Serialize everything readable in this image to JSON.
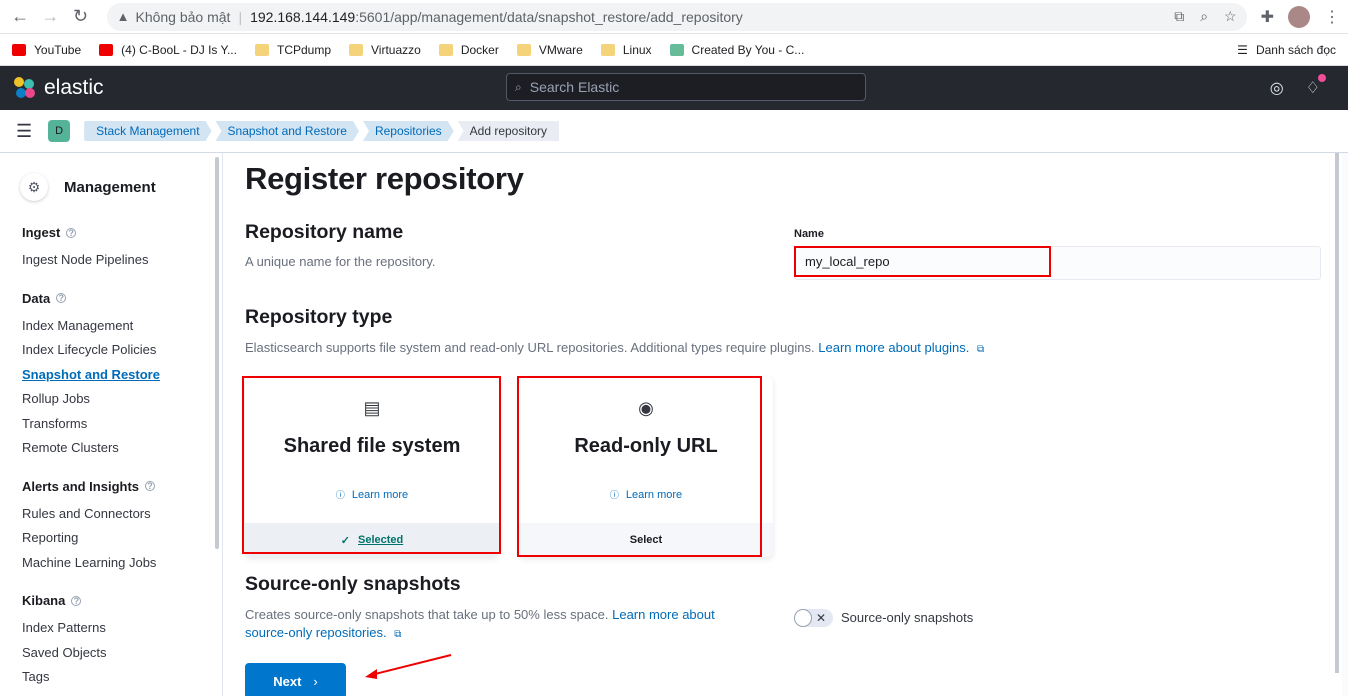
{
  "browser": {
    "insecure_label": "Không bảo mật",
    "url_host": "192.168.144.149",
    "url_path": ":5601/app/management/data/snapshot_restore/add_repository",
    "bookmarks": [
      {
        "label": "YouTube",
        "icon": "youtube-icon"
      },
      {
        "label": "(4) C-BooL - DJ Is Y...",
        "icon": "youtube-icon"
      },
      {
        "label": "TCPdump",
        "icon": "folder-icon"
      },
      {
        "label": "Virtuazzo",
        "icon": "folder-icon"
      },
      {
        "label": "Docker",
        "icon": "folder-icon"
      },
      {
        "label": "VMware",
        "icon": "folder-icon"
      },
      {
        "label": "Linux",
        "icon": "folder-icon"
      },
      {
        "label": "Created By You - C...",
        "icon": "created-icon"
      }
    ],
    "reading_list": "Danh sách đọc"
  },
  "header": {
    "logo_text": "elastic",
    "search_placeholder": "Search Elastic",
    "space_initial": "D"
  },
  "breadcrumbs": [
    "Stack Management",
    "Snapshot and Restore",
    "Repositories",
    "Add repository"
  ],
  "sidenav": {
    "title": "Management",
    "groups": [
      {
        "title": "Ingest",
        "items": [
          "Ingest Node Pipelines"
        ]
      },
      {
        "title": "Data",
        "items": [
          "Index Management",
          "Index Lifecycle Policies",
          "Snapshot and Restore",
          "Rollup Jobs",
          "Transforms",
          "Remote Clusters"
        ]
      },
      {
        "title": "Alerts and Insights",
        "items": [
          "Rules and Connectors",
          "Reporting",
          "Machine Learning Jobs"
        ]
      },
      {
        "title": "Kibana",
        "items": [
          "Index Patterns",
          "Saved Objects",
          "Tags"
        ]
      }
    ]
  },
  "page": {
    "title": "Register repository",
    "repo_name": {
      "heading": "Repository name",
      "description": "A unique name for the repository.",
      "field_label": "Name",
      "field_value": "my_local_repo"
    },
    "repo_type": {
      "heading": "Repository type",
      "description": "Elasticsearch supports file system and read-only URL repositories. Additional types require plugins.",
      "link": "Learn more about plugins.",
      "cards": [
        {
          "title": "Shared file system",
          "learn": "Learn more",
          "action": "Selected",
          "selected": true
        },
        {
          "title": "Read-only URL",
          "learn": "Learn more",
          "action": "Select",
          "selected": false
        }
      ]
    },
    "source_only": {
      "heading": "Source-only snapshots",
      "description": "Creates source-only snapshots that take up to 50% less space.",
      "link_1": "Learn more about",
      "link_2": "source-only repositories.",
      "toggle_label": "Source-only snapshots"
    },
    "next_button": "Next"
  },
  "colors": {
    "accent": "#0077cc",
    "annotation": "#e00000",
    "header_bg": "#25282f"
  }
}
